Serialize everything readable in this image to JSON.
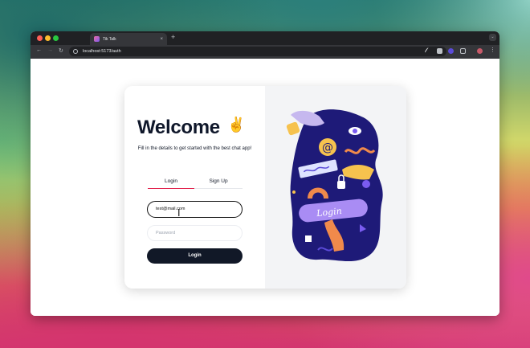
{
  "browser": {
    "tab_title": "Tik Talk",
    "tab_close": "×",
    "new_tab": "+",
    "url": "localhost:5173/auth",
    "back": "←",
    "forward": "→",
    "reload": "↻",
    "star": "☆",
    "menu": "⋮",
    "tab_menu": "⌄"
  },
  "auth": {
    "heading": "Welcome",
    "heading_emoji_icon": "victory-hand-icon",
    "subtitle": "Fill in the details to get started with the best chat app!",
    "tabs": [
      "Login",
      "Sign Up"
    ],
    "active_tab": "Login",
    "email_value": "test@mail.com",
    "password_placeholder": "Password",
    "login_button": "Login",
    "illustration_text": "Login"
  },
  "colors": {
    "accent_underline": "#e11d48",
    "button_bg": "#111827",
    "illustration_bg": "#1e1a78"
  }
}
